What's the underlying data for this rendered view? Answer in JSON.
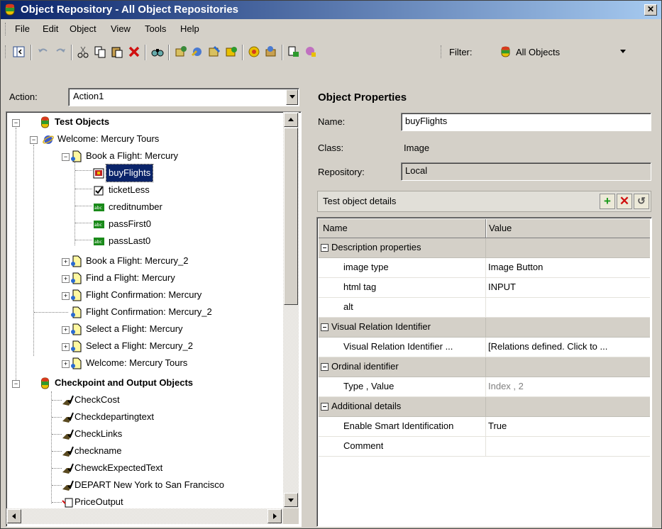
{
  "window": {
    "title": "Object Repository - All Object Repositories"
  },
  "menu": [
    "File",
    "Edit",
    "Object",
    "View",
    "Tools",
    "Help"
  ],
  "toolbar": {
    "buttons": [
      "toggle-pane",
      "undo",
      "redo",
      "cut",
      "copy",
      "paste",
      "delete",
      "find",
      "add-objects",
      "navigate-learn",
      "highlight",
      "locate",
      "add-checkpoint",
      "update-from-app",
      "define-object",
      "object-spy"
    ],
    "filter_label": "Filter:",
    "filter_value": "All Objects"
  },
  "action": {
    "label": "Action:",
    "value": "Action1"
  },
  "tree": {
    "test_objects": "Test Objects",
    "welcome_browser": "Welcome: Mercury Tours",
    "pages": {
      "book_flight": "Book a Flight: Mercury",
      "book_flight_2": "Book a Flight: Mercury_2",
      "find_flight": "Find a Flight: Mercury",
      "flight_confirmation": "Flight Confirmation: Mercury",
      "flight_confirmation_2": "Flight Confirmation: Mercury_2",
      "select_flight": "Select a Flight: Mercury",
      "select_flight_2": "Select a Flight: Mercury_2",
      "welcome_page": "Welcome: Mercury Tours"
    },
    "children": {
      "buy_flights": "buyFlights",
      "ticket_less": "ticketLess",
      "credit_number": "creditnumber",
      "pass_first": "passFirst0",
      "pass_last": "passLast0"
    },
    "checkpoints_title": "Checkpoint and Output Objects",
    "checkpoints": {
      "check_cost": "CheckCost",
      "check_departing": "Checkdepartingtext",
      "check_links": "CheckLinks",
      "check_name": "checkname",
      "check_expected": "ChewckExpectedText",
      "depart": "DEPART New York to San Francisco",
      "price_output": "PriceOutput"
    }
  },
  "properties": {
    "title": "Object Properties",
    "name_label": "Name:",
    "name_value": "buyFlights",
    "class_label": "Class:",
    "class_value": "Image",
    "repository_label": "Repository:",
    "repository_value": "Local",
    "details_title": "Test object details",
    "col_name": "Name",
    "col_value": "Value",
    "rows": {
      "description_properties": "Description properties",
      "image_type_name": "image type",
      "image_type_value": "Image Button",
      "html_tag_name": "html tag",
      "html_tag_value": "INPUT",
      "alt_name": "alt",
      "alt_value": "",
      "visual_relation_cat": "Visual Relation Identifier",
      "visual_relation_name": "Visual Relation Identifier ...",
      "visual_relation_value": "[Relations defined. Click to ...",
      "ordinal_cat": "Ordinal identifier",
      "type_value_name": "Type , Value",
      "type_value_value": "Index , 2",
      "additional_cat": "Additional details",
      "smart_id_name": "Enable Smart Identification",
      "smart_id_value": "True",
      "comment_name": "Comment",
      "comment_value": ""
    }
  },
  "colors": {
    "title_start": "#0a246a",
    "title_end": "#a6caf0",
    "selection": "#0a246a",
    "face": "#d4d0c8"
  }
}
